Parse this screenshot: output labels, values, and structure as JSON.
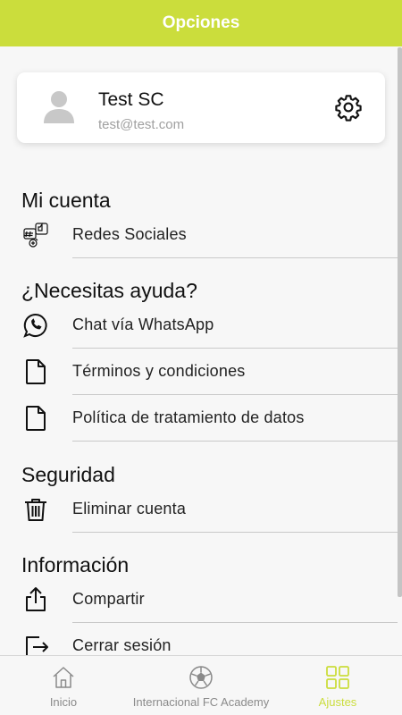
{
  "header": {
    "title": "Opciones"
  },
  "profile": {
    "name": "Test SC",
    "email": "test@test.com"
  },
  "sections": [
    {
      "title": "Mi cuenta",
      "items": [
        {
          "label": "Redes Sociales",
          "icon": "social-networks-icon"
        }
      ]
    },
    {
      "title": "¿Necesitas ayuda?",
      "items": [
        {
          "label": "Chat vía WhatsApp",
          "icon": "whatsapp-icon"
        },
        {
          "label": "Términos y condiciones",
          "icon": "document-icon"
        },
        {
          "label": "Política de tratamiento de datos",
          "icon": "document-icon"
        }
      ]
    },
    {
      "title": "Seguridad",
      "items": [
        {
          "label": "Eliminar cuenta",
          "icon": "trash-icon"
        }
      ]
    },
    {
      "title": "Información",
      "items": [
        {
          "label": "Compartir",
          "icon": "share-icon"
        },
        {
          "label": "Cerrar sesión",
          "icon": "logout-icon"
        }
      ]
    }
  ],
  "tabbar": {
    "tabs": [
      {
        "label": "Inicio",
        "icon": "home-icon"
      },
      {
        "label": "Internacional FC Academy",
        "icon": "soccer-ball-icon"
      },
      {
        "label": "Ajustes",
        "icon": "grid-icon",
        "active": true
      }
    ]
  },
  "colors": {
    "accent": "#cbdd3c",
    "text": "#111111",
    "muted": "#a0a0a0",
    "divider": "#c9c9c9"
  }
}
